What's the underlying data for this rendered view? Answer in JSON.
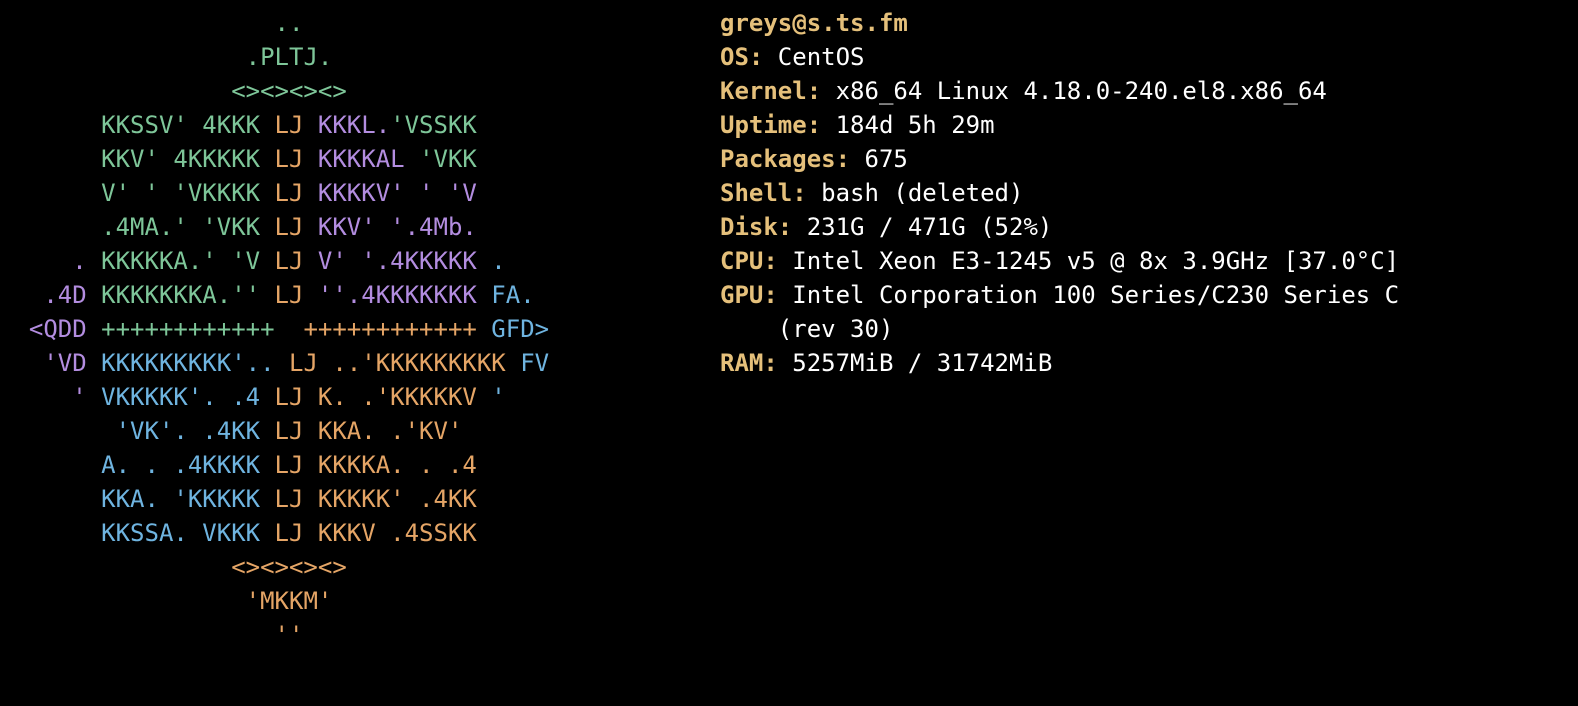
{
  "logo": {
    "lines": [
      {
        "pad": "                   ",
        "segs": [
          {
            "cls": "c-green",
            "t": ".."
          }
        ]
      },
      {
        "pad": "                 ",
        "segs": [
          {
            "cls": "c-green",
            "t": ".PLTJ."
          }
        ]
      },
      {
        "pad": "                ",
        "segs": [
          {
            "cls": "c-green",
            "t": "<><><><>"
          }
        ]
      },
      {
        "pad": "       ",
        "segs": [
          {
            "cls": "c-green",
            "t": "KKSSV' 4KKK "
          },
          {
            "cls": "c-orange",
            "t": "LJ "
          },
          {
            "cls": "c-purple",
            "t": "KKKL."
          },
          {
            "cls": "c-green",
            "t": "'VSSKK"
          }
        ]
      },
      {
        "pad": "       ",
        "segs": [
          {
            "cls": "c-green",
            "t": "KKV' 4KKKKK "
          },
          {
            "cls": "c-orange",
            "t": "LJ "
          },
          {
            "cls": "c-purple",
            "t": "KKKKAL "
          },
          {
            "cls": "c-green",
            "t": "'VKK"
          }
        ]
      },
      {
        "pad": "       ",
        "segs": [
          {
            "cls": "c-green",
            "t": "V' ' 'VKKKK "
          },
          {
            "cls": "c-orange",
            "t": "LJ "
          },
          {
            "cls": "c-purple",
            "t": "KKKKV' ' 'V"
          }
        ]
      },
      {
        "pad": "       ",
        "segs": [
          {
            "cls": "c-green",
            "t": ".4MA.' 'VKK "
          },
          {
            "cls": "c-orange",
            "t": "LJ "
          },
          {
            "cls": "c-purple",
            "t": "KKV' '.4Mb."
          }
        ]
      },
      {
        "pad": "     ",
        "segs": [
          {
            "cls": "c-purple",
            "t": ". "
          },
          {
            "cls": "c-green",
            "t": "KKKKKA.' 'V "
          },
          {
            "cls": "c-orange",
            "t": "LJ "
          },
          {
            "cls": "c-purple",
            "t": "V' '.4KKKKK "
          },
          {
            "cls": "c-blue",
            "t": "."
          }
        ]
      },
      {
        "pad": "   ",
        "segs": [
          {
            "cls": "c-purple",
            "t": ".4D "
          },
          {
            "cls": "c-green",
            "t": "KKKKKKKA.'' "
          },
          {
            "cls": "c-orange",
            "t": "LJ "
          },
          {
            "cls": "c-purple",
            "t": "''.4KKKKKKK "
          },
          {
            "cls": "c-blue",
            "t": "FA."
          }
        ]
      },
      {
        "pad": "  ",
        "segs": [
          {
            "cls": "c-purple",
            "t": "<QDD "
          },
          {
            "cls": "c-green",
            "t": "++++++++++++  "
          },
          {
            "cls": "c-orange",
            "t": "++++++++++++ "
          },
          {
            "cls": "c-blue",
            "t": "GFD>"
          }
        ]
      },
      {
        "pad": "   ",
        "segs": [
          {
            "cls": "c-purple",
            "t": "'VD "
          },
          {
            "cls": "c-blue",
            "t": "KKKKKKKKK'.. "
          },
          {
            "cls": "c-orange",
            "t": "LJ "
          },
          {
            "cls": "c-orange",
            "t": "..'KKKKKKKKK "
          },
          {
            "cls": "c-blue",
            "t": "FV"
          }
        ]
      },
      {
        "pad": "     ",
        "segs": [
          {
            "cls": "c-purple",
            "t": "' "
          },
          {
            "cls": "c-blue",
            "t": "VKKKKK'. .4 "
          },
          {
            "cls": "c-orange",
            "t": "LJ "
          },
          {
            "cls": "c-orange",
            "t": "K. .'KKKKKV "
          },
          {
            "cls": "c-blue",
            "t": "'"
          }
        ]
      },
      {
        "pad": "        ",
        "segs": [
          {
            "cls": "c-blue",
            "t": "'VK'. .4KK "
          },
          {
            "cls": "c-orange",
            "t": "LJ "
          },
          {
            "cls": "c-orange",
            "t": "KKA. .'KV'"
          }
        ]
      },
      {
        "pad": "       ",
        "segs": [
          {
            "cls": "c-blue",
            "t": "A. . .4KKKK "
          },
          {
            "cls": "c-orange",
            "t": "LJ "
          },
          {
            "cls": "c-orange",
            "t": "KKKKA. . .4"
          }
        ]
      },
      {
        "pad": "       ",
        "segs": [
          {
            "cls": "c-blue",
            "t": "KKA. 'KKKKK "
          },
          {
            "cls": "c-orange",
            "t": "LJ "
          },
          {
            "cls": "c-orange",
            "t": "KKKKK' .4KK"
          }
        ]
      },
      {
        "pad": "       ",
        "segs": [
          {
            "cls": "c-blue",
            "t": "KKSSA. VKKK "
          },
          {
            "cls": "c-orange",
            "t": "LJ "
          },
          {
            "cls": "c-orange",
            "t": "KKKV .4SSKK"
          }
        ]
      },
      {
        "pad": "                ",
        "segs": [
          {
            "cls": "c-orange",
            "t": "<><><><>"
          }
        ]
      },
      {
        "pad": "                 ",
        "segs": [
          {
            "cls": "c-orange",
            "t": "'MKKM'"
          }
        ]
      },
      {
        "pad": "                   ",
        "segs": [
          {
            "cls": "c-orange",
            "t": "''"
          }
        ]
      }
    ]
  },
  "info": {
    "user_host": "greys@s.ts.fm",
    "rows": [
      {
        "label": "OS:",
        "value": " CentOS"
      },
      {
        "label": "Kernel:",
        "value": " x86_64 Linux 4.18.0-240.el8.x86_64"
      },
      {
        "label": "Uptime:",
        "value": " 184d 5h 29m"
      },
      {
        "label": "Packages:",
        "value": " 675"
      },
      {
        "label": "Shell:",
        "value": " bash (deleted)"
      },
      {
        "label": "Disk:",
        "value": " 231G / 471G (52%)"
      },
      {
        "label": "CPU:",
        "value": " Intel Xeon E3-1245 v5 @ 8x 3.9GHz [37.0°C]"
      },
      {
        "label": "GPU:",
        "value": " Intel Corporation 100 Series/C230 Series C",
        "cont": "    (rev 30)"
      },
      {
        "label": "RAM:",
        "value": " 5257MiB / 31742MiB"
      }
    ]
  }
}
